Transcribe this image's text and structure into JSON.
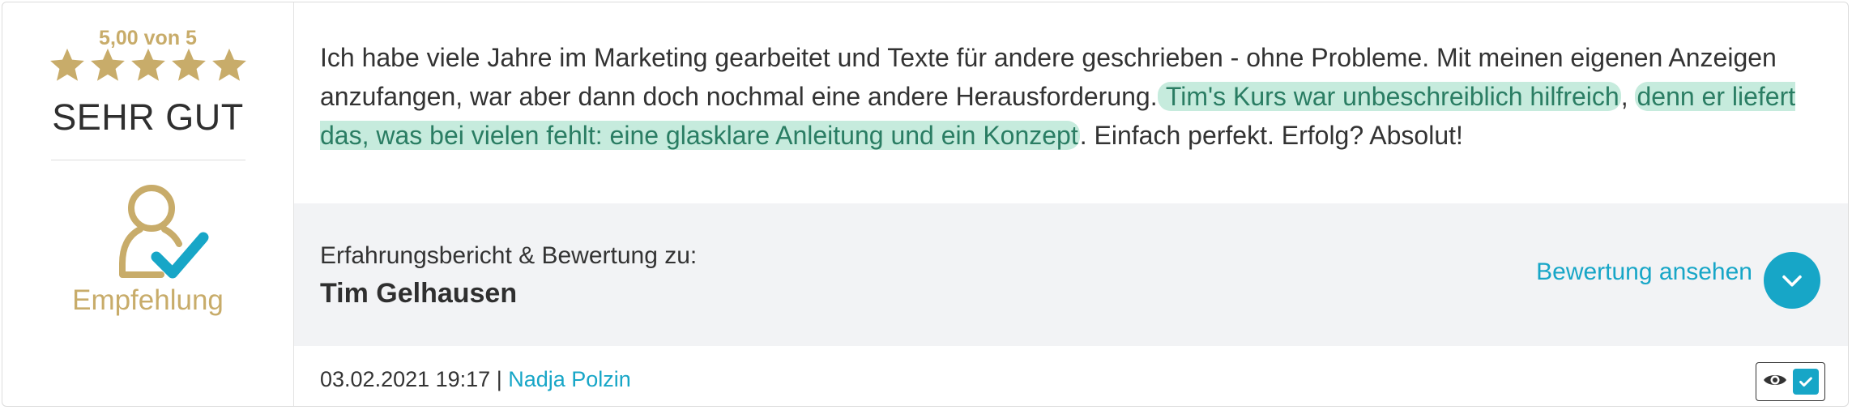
{
  "rating": {
    "score_text": "5,00 von 5",
    "stars": 5,
    "label": "SEHR GUT",
    "star_color": "#c8ac6a"
  },
  "recommendation": {
    "icon": "user-check-icon",
    "label": "Empfehlung"
  },
  "review": {
    "text_before": "Ich habe viele Jahre im Marketing gearbeitet und Texte für andere geschrieben - ohne Probleme. Mit meinen eigenen Anzeigen anzufangen, war aber dann doch nochmal eine andere Herausforderung.",
    "highlight_1": " Tim's Kurs war unbeschreiblich hilfreich",
    "text_mid": ", ",
    "highlight_2": "denn er liefert das, was bei vielen fehlt: eine glasklare Anleitung und ein Konzept",
    "text_after": ". Einfach perfekt. Erfolg? Absolut!",
    "highlight_color": "#c6ebdd"
  },
  "about": {
    "label": "Erfahrungsbericht & Bewertung zu:",
    "name": "Tim Gelhausen",
    "view_link": "Bewertung ansehen",
    "accent_color": "#17a6c7"
  },
  "footer": {
    "datetime": "03.02.2021 19:17",
    "separator": " | ",
    "author": "Nadja Polzin",
    "status_icons": [
      "eye-icon",
      "checkmark-icon"
    ]
  }
}
